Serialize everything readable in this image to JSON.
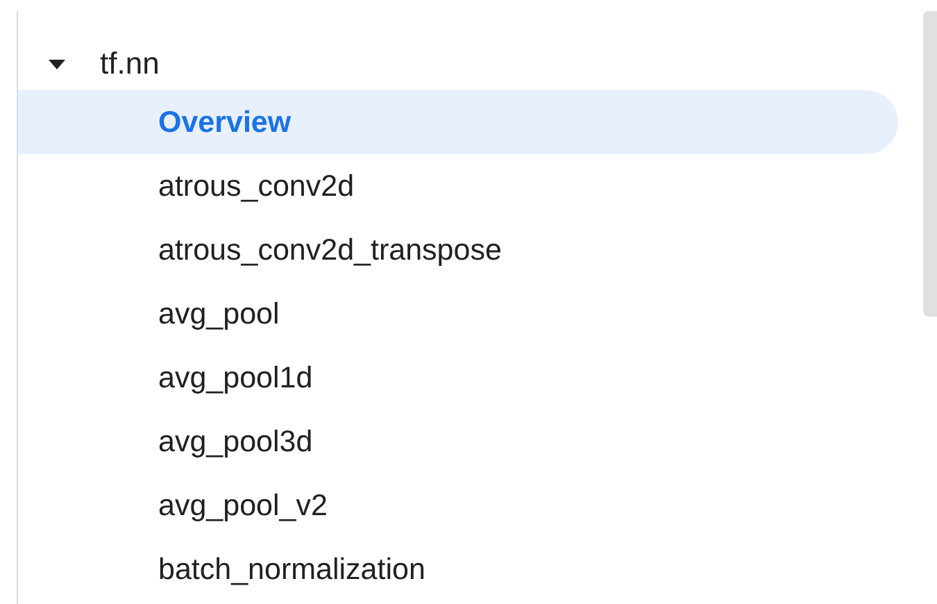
{
  "tree": {
    "label": "tf.nn",
    "expanded": true,
    "children": [
      {
        "label": "Overview",
        "selected": true
      },
      {
        "label": "atrous_conv2d",
        "selected": false
      },
      {
        "label": "atrous_conv2d_transpose",
        "selected": false
      },
      {
        "label": "avg_pool",
        "selected": false
      },
      {
        "label": "avg_pool1d",
        "selected": false
      },
      {
        "label": "avg_pool3d",
        "selected": false
      },
      {
        "label": "avg_pool_v2",
        "selected": false
      },
      {
        "label": "batch_normalization",
        "selected": false
      }
    ]
  }
}
